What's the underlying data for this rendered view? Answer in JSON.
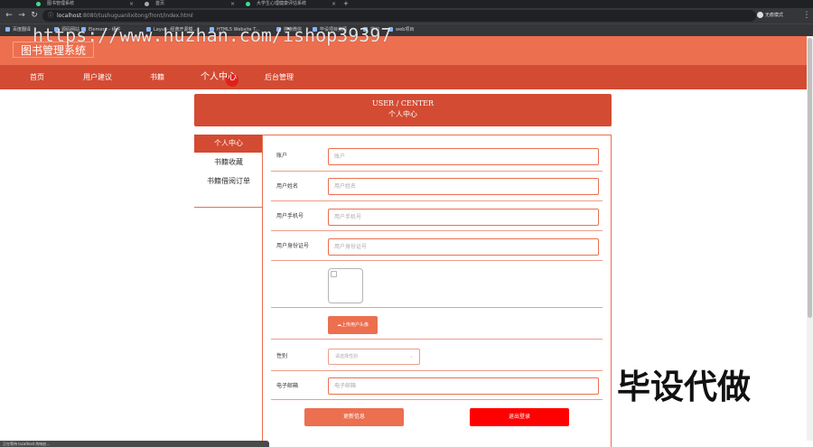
{
  "browser": {
    "tabs": [
      {
        "title": "图书管理系统"
      },
      {
        "title": "首页"
      },
      {
        "title": "大学生心理健康评估系统"
      }
    ],
    "new_tab": "+",
    "url_host": "localhost",
    "url_path": ":8080/tushuguanlixitong/front/index.html",
    "profile_label": "无痕模式",
    "bookmarks": [
      {
        "label": "百度翻译"
      },
      {
        "label": "源码网站"
      },
      {
        "label": "Element - 组件"
      },
      {
        "label": "Layui - 经典开源模..."
      },
      {
        "label": "HTML5 Website T..."
      },
      {
        "label": "搜索微信"
      },
      {
        "label": "毕设项目资源"
      },
      {
        "label": "学习"
      },
      {
        "label": "web项目"
      }
    ]
  },
  "site": {
    "title": "图书管理系统",
    "nav": [
      {
        "label": "首页"
      },
      {
        "label": "用户建议"
      },
      {
        "label": "书籍"
      },
      {
        "label": "个人中心"
      },
      {
        "label": "后台管理"
      }
    ]
  },
  "panel": {
    "title_en": "USER / CENTER",
    "title_cn": "个人中心"
  },
  "side_menu": [
    {
      "label": "个人中心"
    },
    {
      "label": "书籍收藏"
    },
    {
      "label": "书籍借阅订单"
    }
  ],
  "form": {
    "account": {
      "label": "账户",
      "placeholder": "账户"
    },
    "name": {
      "label": "用户姓名",
      "placeholder": "用户姓名"
    },
    "phone": {
      "label": "用户手机号",
      "placeholder": "用户手机号"
    },
    "idcard": {
      "label": "用户身份证号",
      "placeholder": "用户身份证号"
    },
    "upload_label": "上传用户头像",
    "gender": {
      "label": "性别",
      "placeholder": "请选择性别"
    },
    "email": {
      "label": "电子邮箱",
      "placeholder": "电子邮箱"
    },
    "update_label": "更新信息",
    "logout_label": "退出登录"
  },
  "overlay": {
    "watermark": "https://www.huzhan.com/ishop39397",
    "promo": "毕设代做"
  },
  "status_bar": "正在等待 localhost 的响应...",
  "colors": {
    "header": "#ec6f4f",
    "nav": "#d34b33",
    "logout": "#ff0000"
  }
}
